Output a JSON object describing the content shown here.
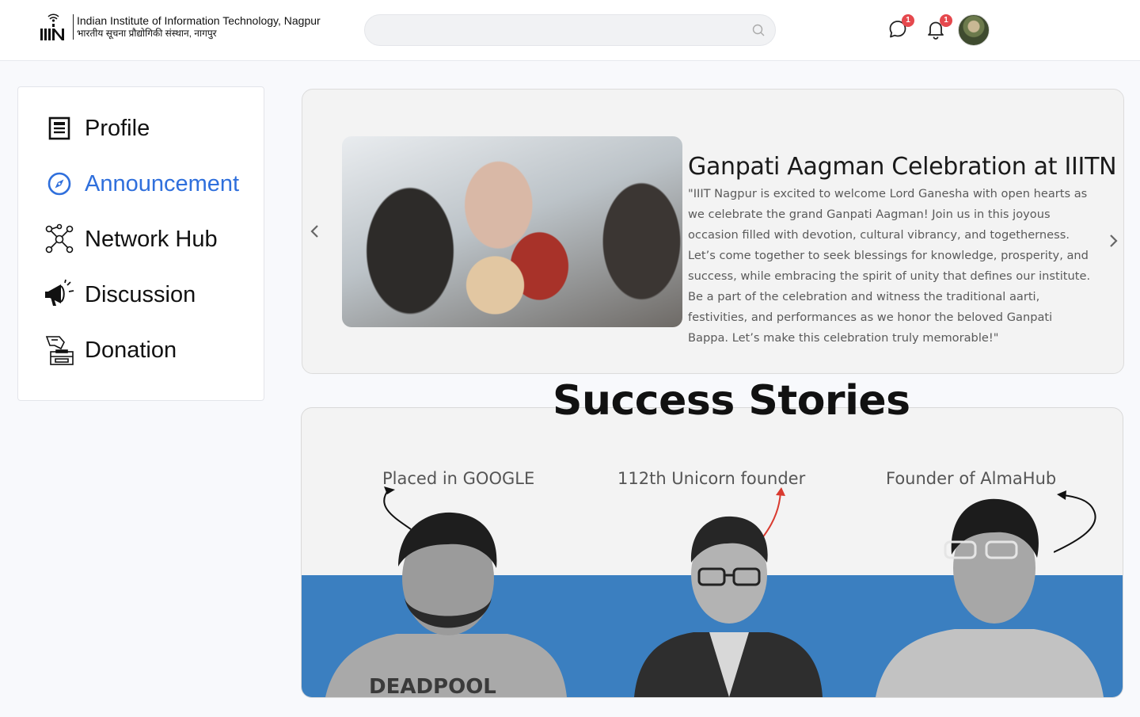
{
  "header": {
    "institute_name_en": "Indian Institute of Information Technology, Nagpur",
    "institute_name_hi": "भारतीय सूचना प्रौद्योगिकी संस्थान, नागपुर",
    "search_placeholder": "",
    "messages_badge": "1",
    "notifications_badge": "1"
  },
  "sidebar": {
    "items": [
      {
        "label": "Profile",
        "icon": "document-icon"
      },
      {
        "label": "Announcement",
        "icon": "compass-icon",
        "active": true
      },
      {
        "label": "Network Hub",
        "icon": "network-icon"
      },
      {
        "label": "Discussion",
        "icon": "megaphone-icon"
      },
      {
        "label": "Donation",
        "icon": "donation-box-icon"
      }
    ]
  },
  "announcement": {
    "title": "Ganpati Aagman Celebration at IIITN",
    "body": "\"IIIT Nagpur is excited to welcome Lord Ganesha with open hearts as we celebrate the grand Ganpati Aagman! Join us in this joyous occasion filled with devotion, cultural vibrancy, and togetherness. Let’s come together to seek blessings for knowledge, prosperity, and success, while embracing the spirit of unity that defines our institute. Be a part of the celebration and witness the traditional aarti, festivities, and performances as we honor the beloved Ganpati Bappa. Let’s make this celebration truly memorable!\""
  },
  "success_stories": {
    "title": "Success Stories",
    "stories": [
      {
        "caption": "Placed in GOOGLE"
      },
      {
        "caption": "112th Unicorn founder"
      },
      {
        "caption": "Founder of AlmaHub"
      }
    ]
  },
  "colors": {
    "accent": "#2f6fdc",
    "badge": "#e5484d",
    "band": "#3b7fc0",
    "red_arrow": "#d93a2f"
  }
}
